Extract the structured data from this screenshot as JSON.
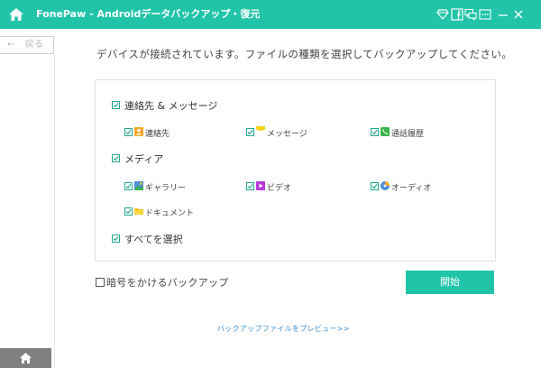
{
  "window": {
    "title": "FonePaw - Androidデータバックアップ・復元",
    "icons": [
      "home-icon",
      "diamond-icon",
      "facebook-icon",
      "chat-icon",
      "menu-icon",
      "minimize-icon",
      "close-icon"
    ]
  },
  "back_button": {
    "arrow": "←",
    "label": "戻る"
  },
  "instruction": "デバイスが接続されています。ファイルの種類を選択してバックアップしてください。",
  "categories": {
    "contacts_messages": {
      "label": "連絡先 & メッセージ",
      "checked": true,
      "items": [
        {
          "label": "連絡先",
          "icon": "contacts-icon",
          "checked": true
        },
        {
          "label": "メッセージ",
          "icon": "message-icon",
          "checked": true
        },
        {
          "label": "通話履歴",
          "icon": "phone-icon",
          "checked": true
        }
      ]
    },
    "media": {
      "label": "メディア",
      "checked": true,
      "items": [
        {
          "label": "ギャラリー",
          "icon": "gallery-icon",
          "checked": true
        },
        {
          "label": "ビデオ",
          "icon": "video-icon",
          "checked": true
        },
        {
          "label": "オーディオ",
          "icon": "audio-icon",
          "checked": true
        },
        {
          "label": "ドキュメント",
          "icon": "folder-icon",
          "checked": true
        }
      ]
    },
    "select_all": {
      "label": "すべてを選択",
      "checked": true
    }
  },
  "encrypt": {
    "label": "暗号をかけるバックアップ",
    "checked": false
  },
  "start_button": {
    "label": "開始"
  },
  "preview_link": "バックアップファイルをプレビュー>>",
  "colors": {
    "accent": "#21c4a8",
    "check": "#21a88f",
    "link": "#3a8fd0"
  }
}
